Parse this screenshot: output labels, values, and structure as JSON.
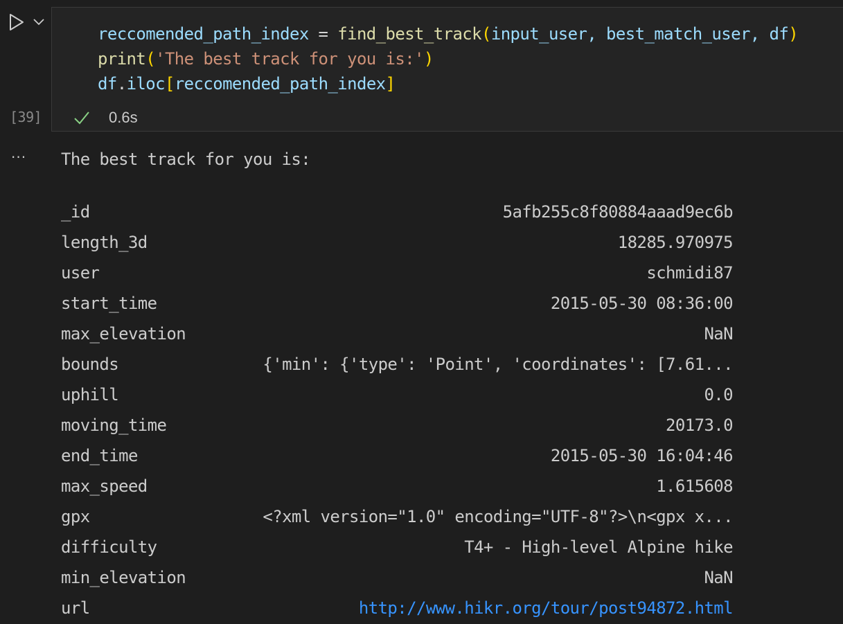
{
  "cell": {
    "exec_count": "[39]",
    "duration": "0.6s",
    "code": {
      "line1": {
        "var": "reccomended_path_index",
        "eq": " = ",
        "fn": "find_best_track",
        "open": "(",
        "args": "input_user, best_match_user, df",
        "close": ")"
      },
      "line2": {
        "fn": "print",
        "open": "(",
        "str": "'The best track for you is:'",
        "close": ")"
      },
      "line3": {
        "obj": "df",
        "dot": ".",
        "attr": "iloc",
        "open": "[",
        "arg": "reccomended_path_index",
        "close": "]"
      }
    }
  },
  "output": {
    "menu": "···",
    "print_text": "The best track for you is:",
    "rows": [
      {
        "key": "_id",
        "value": "5afb255c8f80884aaad9ec6b"
      },
      {
        "key": "length_3d",
        "value": "18285.970975"
      },
      {
        "key": "user",
        "value": "schmidi87"
      },
      {
        "key": "start_time",
        "value": "2015-05-30 08:36:00"
      },
      {
        "key": "max_elevation",
        "value": "NaN"
      },
      {
        "key": "bounds",
        "value": "{'min': {'type': 'Point', 'coordinates': [7.61..."
      },
      {
        "key": "uphill",
        "value": "0.0"
      },
      {
        "key": "moving_time",
        "value": "20173.0"
      },
      {
        "key": "end_time",
        "value": "2015-05-30 16:04:46"
      },
      {
        "key": "max_speed",
        "value": "1.615608"
      },
      {
        "key": "gpx",
        "value": "<?xml version=\"1.0\" encoding=\"UTF-8\"?>\\n<gpx x..."
      },
      {
        "key": "difficulty",
        "value": "T4+ - High-level Alpine hike"
      },
      {
        "key": "min_elevation",
        "value": "NaN"
      },
      {
        "key": "url",
        "value": "http://www.hikr.org/tour/post94872.html"
      }
    ]
  },
  "colors": {
    "background": "#1e1e1e",
    "cell_background": "#242424",
    "success": "#89d185",
    "link": "#3794ff"
  },
  "icons": {
    "run": "play-icon",
    "run_menu": "chevron-down-icon",
    "status": "check-icon",
    "output_menu": "ellipsis-icon"
  }
}
